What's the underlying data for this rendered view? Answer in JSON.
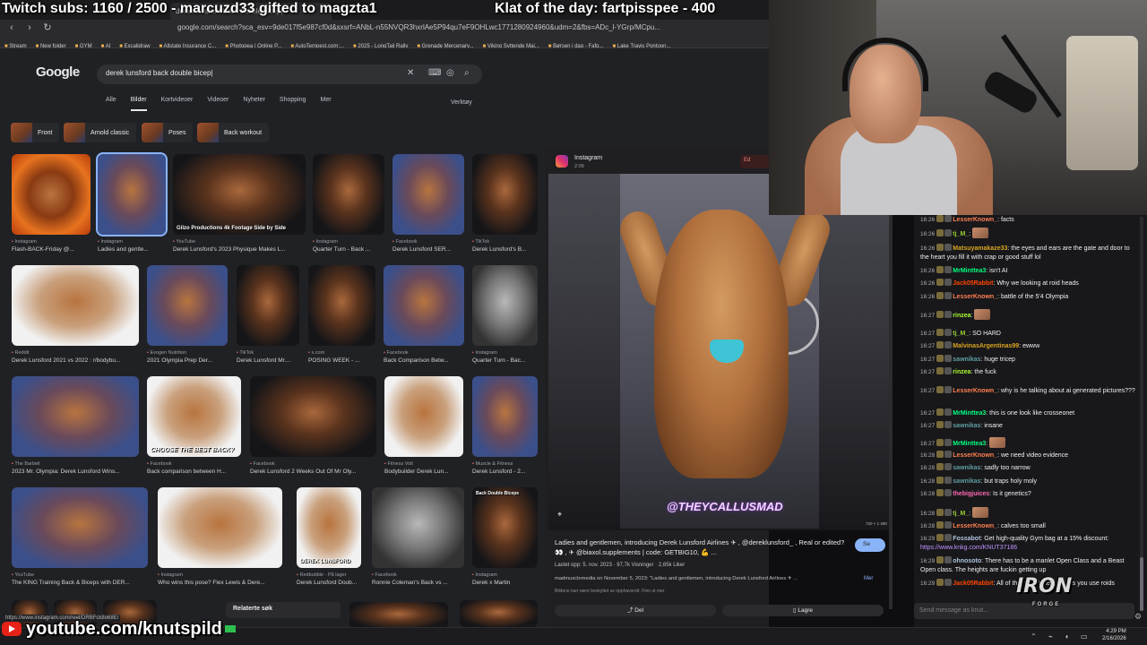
{
  "overlay": {
    "subs": "Twitch subs: 1160 / 2500 - marcuzd33 gifted to magzta1",
    "klat": "Klat of the day: fartpisspee - 400",
    "youtube": "youtube.com/knutspild"
  },
  "browser": {
    "url": "google.com/search?sca_esv=9de017f5e987cf0d&sxsrf=ANbL-n55NVQR3hxrlAe5P94qu7eF9OHLwc1771280924960&udm=2&fbs=ADc_l-YGrp/MCpu...",
    "bookmarks": [
      "Stream",
      "New folder",
      "GYM",
      "AI",
      "Excalidraw",
      "Allstate Insurance C...",
      "Photopea | Online P...",
      "AutoTempest.com:...",
      "2025 - LongTail Rally",
      "Grenade Mercenary...",
      "Viking Syttende Mai...",
      "Børsen i dag - Fafg...",
      "Lake Travis Pontoon..."
    ],
    "hover_url": "https://www.instagram.com/reel/DRBFck8o68E/"
  },
  "google": {
    "logo": "Google",
    "query": "derek lunsford back double bicep|",
    "tabs": [
      "Alle",
      "Bilder",
      "Kortvideoer",
      "Videoer",
      "Nyheter",
      "Shopping",
      "Mer"
    ],
    "active_tab": "Bilder",
    "tools": "Verktøy",
    "chips": [
      "Front",
      "Arnold classic",
      "Poses",
      "Back workout"
    ],
    "related": "Relaterte søk"
  },
  "results": [
    {
      "src": "Instagram",
      "title": "Flash-BACK-Friday @..."
    },
    {
      "src": "Instagram",
      "title": "Ladies and gentle..."
    },
    {
      "src": "YouTube",
      "title": "Derek Lunsford's 2023 Physique Makes L..."
    },
    {
      "src": "Instagram",
      "title": "Quarter Turn - Back ..."
    },
    {
      "src": "Facebook",
      "title": "Derek Lunsford SER..."
    },
    {
      "src": "TikTok",
      "title": "Derek Lunsford's B..."
    },
    {
      "src": "Reddit",
      "title": "Derek Lunsford 2021 vs 2022 : r/bodybu..."
    },
    {
      "src": "Evogen Nutrition",
      "title": "2021 Olympia Prep Der..."
    },
    {
      "src": "TikTok",
      "title": "Derek Lunsford Mr...."
    },
    {
      "src": "x.com",
      "title": "POSING WEEK - ..."
    },
    {
      "src": "Facebook",
      "title": "Back Comparison Betw..."
    },
    {
      "src": "Instagram",
      "title": "Quarter Turn - Bac..."
    },
    {
      "src": "The Barbell",
      "title": "2023 Mr. Olympia: Derek Lunsford Wins..."
    },
    {
      "src": "Facebook",
      "title": "Back comparison between H..."
    },
    {
      "src": "Facebook",
      "title": "Derek Lunsford 2 Weeks Out Of Mr Oly..."
    },
    {
      "src": "Fitness Volt",
      "title": "Bodybuilder Derek Lun..."
    },
    {
      "src": "Muscle & Fitness",
      "title": "Derek Lunsford - 2..."
    },
    {
      "src": "YouTube",
      "title": "The KING Training Back & Biceps with DER..."
    },
    {
      "src": "Instagram",
      "title": "Who wins this pose? Flex Lewis & Dere..."
    },
    {
      "src": "Redbubble · På lager",
      "title": "Derek Lunsford Doub..."
    },
    {
      "src": "Facebook",
      "title": "Ronnie Coleman's Back vs ..."
    },
    {
      "src": "Instagram",
      "title": "Derek x Martin"
    }
  ],
  "thumb_text": {
    "grid3": "Gilzo Productions 4k Footage Side by Side",
    "grid14": "CHOOSE THE BEST BACK?",
    "grid20": "DEREK LUNSFORD",
    "grid23": "Back Double Biceps"
  },
  "preview": {
    "source": "Instagram",
    "source_sub": "2:09",
    "ed_label": "Ed",
    "watermark": "@THEYCALLUSMAD",
    "dimensions": "720 × 1 280",
    "title": "Ladies and gentlemen, introducing Derek Lunsford Airlines ✈ , @dereklunsford_ , Real or edited? 👀 , ✈ @biaxol.supplements | code: GETBIG10, 💪 ...",
    "se_label": "Se",
    "meta": "Lastet opp: 5. nov. 2023 · 97,7k Visninger · 2,65k Liker",
    "desc": "madmusclemedia on November 5, 2023: \"Ladies and gentlemen, introducing Derek Lunsford Airlines ✈ ...",
    "more": "Mer",
    "copyright": "Bildene kan være beskyttet av opphavsrett. Finn ut mer",
    "share": "Del",
    "save": "Lagre"
  },
  "chat": {
    "input_placeholder": "Send message as knut...",
    "messages": [
      {
        "ts": "16:26",
        "user": "LesserKnown_",
        "color": "#ff7f50",
        "text": "facts"
      },
      {
        "ts": "16:26",
        "user": "tj_M_",
        "color": "#9acd32",
        "text": ""
      },
      {
        "ts": "16:26",
        "user": "Matsuyamakaze33",
        "color": "#daa520",
        "text": "the eyes and ears are the gate and door to the heart you fill it with crap or good stuff lol"
      },
      {
        "ts": "16:26",
        "user": "MrMinttea3",
        "color": "#00ff7f",
        "text": "isn't AI"
      },
      {
        "ts": "16:26",
        "user": "Jack05Rabbit",
        "color": "#ff4500",
        "text": "Why we looking at roid heads"
      },
      {
        "ts": "16:26",
        "user": "LesserKnown_",
        "color": "#ff7f50",
        "text": "battle of the 5'4 Olympia"
      },
      {
        "ts": "16:27",
        "user": "rinzea",
        "color": "#adff2f",
        "text": ""
      },
      {
        "ts": "16:27",
        "user": "tj_M_",
        "color": "#9acd32",
        "text": "SO HARD"
      },
      {
        "ts": "16:27",
        "user": "MalvinasArgentinas99",
        "color": "#daa520",
        "text": "ewww"
      },
      {
        "ts": "16:27",
        "user": "sawnikas",
        "color": "#5f9ea0",
        "text": "huge tricep"
      },
      {
        "ts": "16:27",
        "user": "rinzea",
        "color": "#adff2f",
        "text": "the fuck"
      },
      {
        "ts": "16:27",
        "user": "LesserKnown_",
        "color": "#ff7f50",
        "text": "why is he talking about ai generated pictures???"
      },
      {
        "ts": "16:27",
        "user": "MrMinttea3",
        "color": "#00ff7f",
        "text": "this is one look like crosseonet"
      },
      {
        "ts": "16:27",
        "user": "sawnikas",
        "color": "#5f9ea0",
        "text": "insane"
      },
      {
        "ts": "16:27",
        "user": "MrMinttea3",
        "color": "#00ff7f",
        "text": ""
      },
      {
        "ts": "16:28",
        "user": "LesserKnown_",
        "color": "#ff7f50",
        "text": "we need video evidence"
      },
      {
        "ts": "16:28",
        "user": "sawnikas",
        "color": "#5f9ea0",
        "text": "sadly too narrow"
      },
      {
        "ts": "16:28",
        "user": "sawnikas",
        "color": "#5f9ea0",
        "text": "but traps holy moly"
      },
      {
        "ts": "16:28",
        "user": "thebigjuices",
        "color": "#ff69b4",
        "text": "Is it genetics?"
      },
      {
        "ts": "16:28",
        "user": "tj_M_",
        "color": "#9acd32",
        "text": ""
      },
      {
        "ts": "16:28",
        "user": "LesserKnown_",
        "color": "#ff7f50",
        "text": "calves too small"
      },
      {
        "ts": "16:29",
        "user": "Fossabot",
        "color": "#b0c4de",
        "text": "Get high-quality Gym bag at a 15% discount:",
        "link": "https://www.knkg.com/KNUT37186"
      },
      {
        "ts": "16:29",
        "user": "ohnosoto",
        "color": "#b0c4de",
        "text": "There has to be a manlet Open Class and a Beast Open class. The heights are fuckin getting up"
      },
      {
        "ts": "16:29",
        "user": "Jack05Rabbit",
        "color": "#ff4500",
        "text": "All of them... let there unless you use roids"
      }
    ]
  },
  "branding": {
    "iron_logo": "IRON",
    "iron_sub": "FORGE"
  },
  "clock": {
    "time": "4:29 PM",
    "date": "2/16/2026"
  }
}
